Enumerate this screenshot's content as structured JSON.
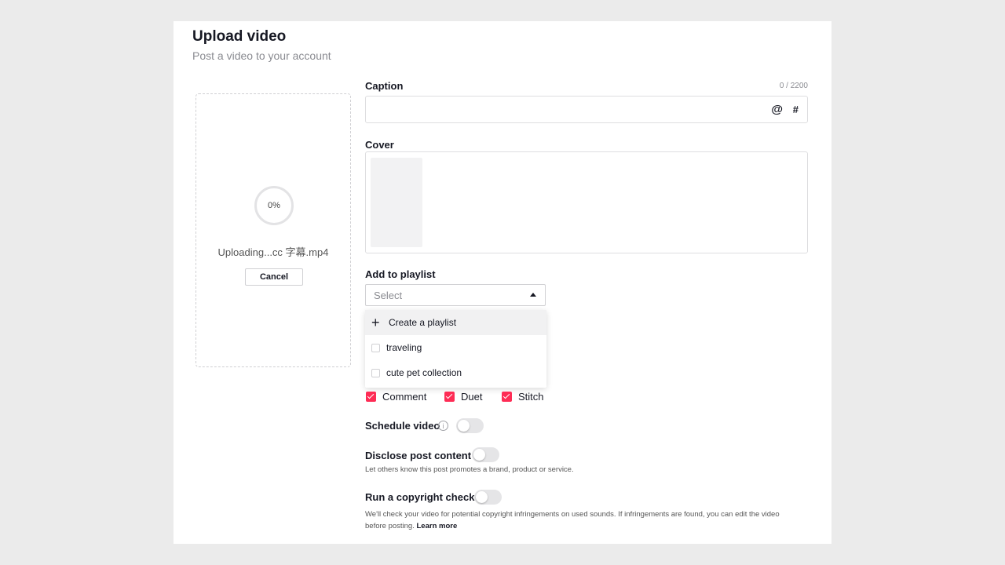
{
  "header": {
    "title": "Upload video",
    "subtitle": "Post a video to your account"
  },
  "upload": {
    "progress_label": "0%",
    "progress_value": 0,
    "file_name": "Uploading...cc 字幕.mp4",
    "cancel_label": "Cancel"
  },
  "caption": {
    "label": "Caption",
    "counter": "0 / 2200",
    "value": "",
    "mention_icon": "at-icon",
    "mention_glyph": "@",
    "hashtag_icon": "hashtag-icon",
    "hashtag_glyph": "#"
  },
  "cover": {
    "label": "Cover"
  },
  "playlist": {
    "label": "Add to playlist",
    "placeholder": "Select",
    "create_label": "Create a playlist",
    "create_glyph": "+",
    "options": [
      {
        "label": "traveling",
        "checked": false
      },
      {
        "label": "cute pet collection",
        "checked": false
      }
    ]
  },
  "permissions": {
    "items": [
      {
        "label": "Comment",
        "checked": true
      },
      {
        "label": "Duet",
        "checked": true
      },
      {
        "label": "Stitch",
        "checked": true
      }
    ]
  },
  "schedule": {
    "label": "Schedule video",
    "info_glyph": "i",
    "enabled": false
  },
  "disclose": {
    "label": "Disclose post content",
    "hint": "Let others know this post promotes a brand, product or service.",
    "enabled": false
  },
  "copyright": {
    "label": "Run a copyright check",
    "hint_line1": "We'll check your video for potential copyright infringements on used sounds. If infringements are found, you can edit the video",
    "hint_line2": "before posting.",
    "learn_more": "Learn more",
    "enabled": false
  },
  "colors": {
    "accent": "#fe2c55",
    "background": "#ebebeb",
    "panel": "#ffffff",
    "text": "#161823",
    "muted": "#8a8b91"
  }
}
